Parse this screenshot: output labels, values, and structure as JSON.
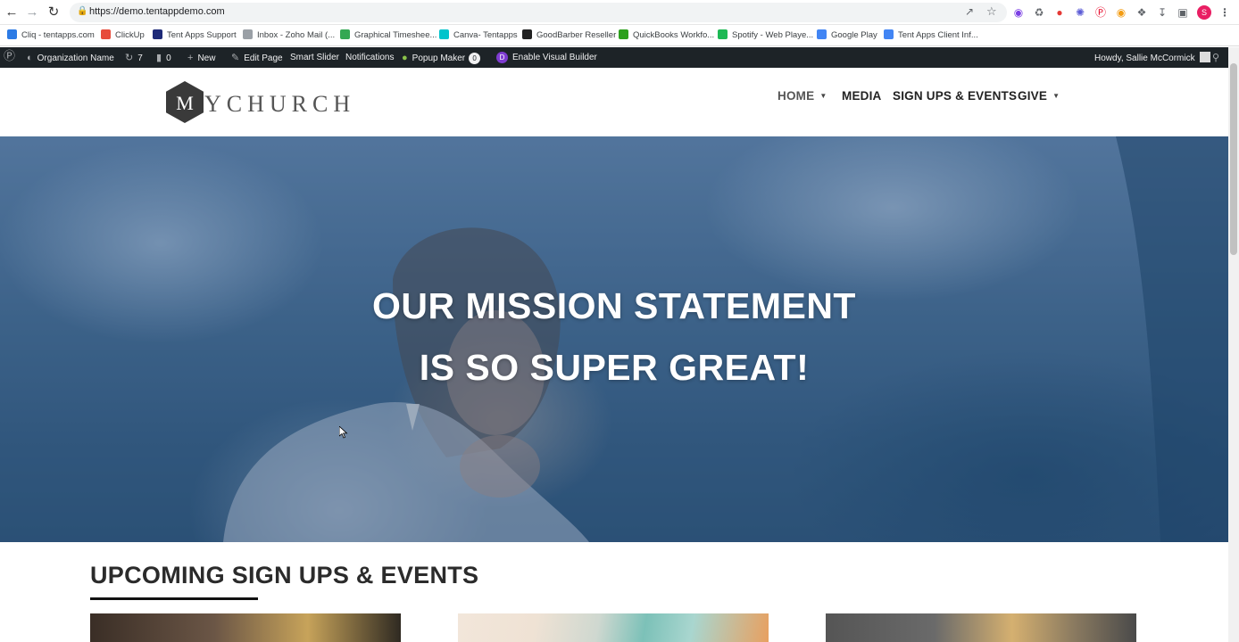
{
  "browser": {
    "url": "https://demo.tentappdemo.com",
    "profile_initial": "S",
    "bookmarks": [
      {
        "label": "Cliq - tentapps.com",
        "color": "#2c7be5"
      },
      {
        "label": "ClickUp",
        "color": "#e74c3c"
      },
      {
        "label": "Tent Apps Support",
        "color": "#1e2a78"
      },
      {
        "label": "Inbox - Zoho Mail (...",
        "color": "#9aa0a6"
      },
      {
        "label": "Graphical Timeshee...",
        "color": "#34a853"
      },
      {
        "label": "Canva- Tentapps",
        "color": "#00c4cc"
      },
      {
        "label": "GoodBarber Reseller",
        "color": "#222222"
      },
      {
        "label": "QuickBooks Workfo...",
        "color": "#2ca01c"
      },
      {
        "label": "Spotify - Web Playe...",
        "color": "#1db954"
      },
      {
        "label": "Google Play",
        "color": "#4285f4"
      },
      {
        "label": "Tent Apps Client Inf...",
        "color": "#4285f4"
      }
    ]
  },
  "wpbar": {
    "site_name": "Organization Name",
    "updates": "7",
    "comments": "0",
    "new": "New",
    "edit_page": "Edit Page",
    "smart_slider": "Smart Slider",
    "notifications": "Notifications",
    "popup_maker": "Popup Maker",
    "popup_count": "0",
    "visual_builder": "Enable Visual Builder",
    "howdy": "Howdy, Sallie McCormick"
  },
  "site": {
    "logo_letter": "M",
    "logo_text": "YCHURCH",
    "menu": {
      "home": "HOME",
      "media": "MEDIA",
      "signups": "SIGN UPS & EVENTS",
      "give": "GIVE"
    }
  },
  "hero": {
    "line1": "OUR MISSION STATEMENT",
    "line2": "IS SO SUPER GREAT!"
  },
  "section": {
    "title": "UPCOMING SIGN UPS & EVENTS"
  }
}
